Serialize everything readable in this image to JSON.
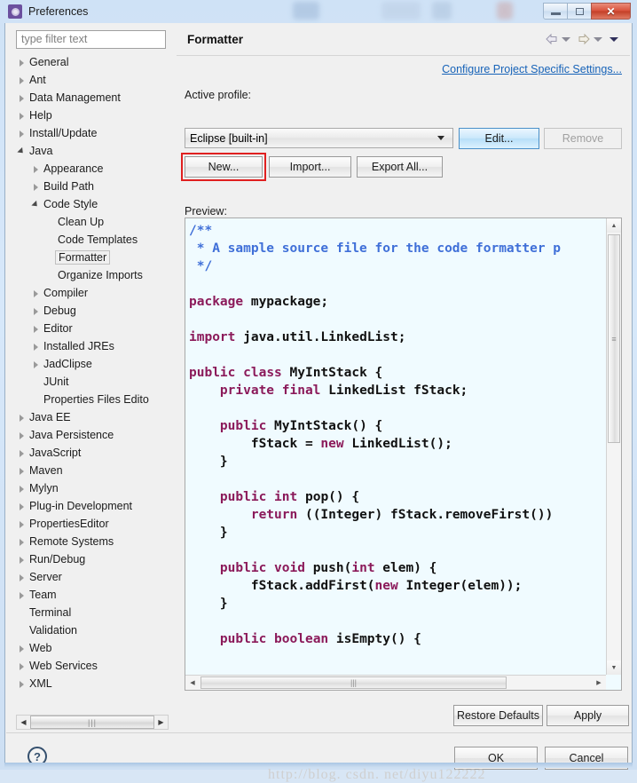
{
  "window": {
    "title": "Preferences",
    "icon": "preferences-icon",
    "minimize_label": "",
    "restore_label": "",
    "close_label": "✕"
  },
  "sidebar": {
    "filter_placeholder": "type filter text",
    "filter_value": "",
    "items": [
      {
        "label": "General",
        "indent": 0,
        "state": "collapsed"
      },
      {
        "label": "Ant",
        "indent": 0,
        "state": "collapsed"
      },
      {
        "label": "Data Management",
        "indent": 0,
        "state": "collapsed"
      },
      {
        "label": "Help",
        "indent": 0,
        "state": "collapsed"
      },
      {
        "label": "Install/Update",
        "indent": 0,
        "state": "collapsed"
      },
      {
        "label": "Java",
        "indent": 0,
        "state": "expanded"
      },
      {
        "label": "Appearance",
        "indent": 1,
        "state": "collapsed"
      },
      {
        "label": "Build Path",
        "indent": 1,
        "state": "collapsed"
      },
      {
        "label": "Code Style",
        "indent": 1,
        "state": "expanded"
      },
      {
        "label": "Clean Up",
        "indent": 2,
        "state": "leaf"
      },
      {
        "label": "Code Templates",
        "indent": 2,
        "state": "leaf"
      },
      {
        "label": "Formatter",
        "indent": 2,
        "state": "leaf",
        "selected": true
      },
      {
        "label": "Organize Imports",
        "indent": 2,
        "state": "leaf"
      },
      {
        "label": "Compiler",
        "indent": 1,
        "state": "collapsed"
      },
      {
        "label": "Debug",
        "indent": 1,
        "state": "collapsed"
      },
      {
        "label": "Editor",
        "indent": 1,
        "state": "collapsed"
      },
      {
        "label": "Installed JREs",
        "indent": 1,
        "state": "collapsed"
      },
      {
        "label": "JadClipse",
        "indent": 1,
        "state": "collapsed"
      },
      {
        "label": "JUnit",
        "indent": 1,
        "state": "leaf"
      },
      {
        "label": "Properties Files Edito",
        "indent": 1,
        "state": "leaf"
      },
      {
        "label": "Java EE",
        "indent": 0,
        "state": "collapsed"
      },
      {
        "label": "Java Persistence",
        "indent": 0,
        "state": "collapsed"
      },
      {
        "label": "JavaScript",
        "indent": 0,
        "state": "collapsed"
      },
      {
        "label": "Maven",
        "indent": 0,
        "state": "collapsed"
      },
      {
        "label": "Mylyn",
        "indent": 0,
        "state": "collapsed"
      },
      {
        "label": "Plug-in Development",
        "indent": 0,
        "state": "collapsed"
      },
      {
        "label": "PropertiesEditor",
        "indent": 0,
        "state": "collapsed"
      },
      {
        "label": "Remote Systems",
        "indent": 0,
        "state": "collapsed"
      },
      {
        "label": "Run/Debug",
        "indent": 0,
        "state": "collapsed"
      },
      {
        "label": "Server",
        "indent": 0,
        "state": "collapsed"
      },
      {
        "label": "Team",
        "indent": 0,
        "state": "collapsed"
      },
      {
        "label": "Terminal",
        "indent": 0,
        "state": "leaf"
      },
      {
        "label": "Validation",
        "indent": 0,
        "state": "leaf"
      },
      {
        "label": "Web",
        "indent": 0,
        "state": "collapsed"
      },
      {
        "label": "Web Services",
        "indent": 0,
        "state": "collapsed"
      },
      {
        "label": "XML",
        "indent": 0,
        "state": "collapsed"
      }
    ],
    "hscroll": {
      "left_arrow": "◀",
      "right_arrow": "▶",
      "grip": "|||"
    }
  },
  "panel": {
    "title": "Formatter",
    "nav": {
      "back_icon": "back-arrow-icon",
      "back_menu_icon": "chevron-down-icon",
      "forward_icon": "forward-arrow-icon",
      "forward_menu_icon": "chevron-down-icon",
      "menu_icon": "chevron-down-icon"
    },
    "configure_link": "Configure Project Specific Settings...",
    "active_profile_label": "Active profile:",
    "profile_value": "Eclipse [built-in]",
    "profile_options": [
      "Eclipse [built-in]"
    ],
    "buttons": {
      "edit": "Edit...",
      "remove": "Remove",
      "new": "New...",
      "import": "Import...",
      "export_all": "Export All..."
    },
    "preview_label": "Preview:",
    "highlight_color": "#e02020",
    "link_color": "#1763b8"
  },
  "preview": {
    "language": "java",
    "comment_color": "#3f6fd8",
    "keyword_color": "#8b1a5a",
    "background": "#f0fbff",
    "code_lines": [
      "/**",
      " * A sample source file for the code formatter p",
      " */",
      "",
      "package mypackage;",
      "",
      "import java.util.LinkedList;",
      "",
      "public class MyIntStack {",
      "    private final LinkedList fStack;",
      "",
      "    public MyIntStack() {",
      "        fStack = new LinkedList();",
      "    }",
      "",
      "    public int pop() {",
      "        return ((Integer) fStack.removeFirst())",
      "    }",
      "",
      "    public void push(int elem) {",
      "        fStack.addFirst(new Integer(elem));",
      "    }",
      "",
      "    public boolean isEmpty() {"
    ],
    "vscroll": {
      "up": "▲",
      "down": "▼",
      "grip": "≡"
    },
    "hscroll": {
      "left": "◀",
      "right": "▶",
      "grip": "|||"
    }
  },
  "footer": {
    "restore_defaults": "Restore Defaults",
    "apply": "Apply",
    "help_icon": "?",
    "ok": "OK",
    "cancel": "Cancel"
  },
  "watermark": "http://blog. csdn. net/diyu122222"
}
